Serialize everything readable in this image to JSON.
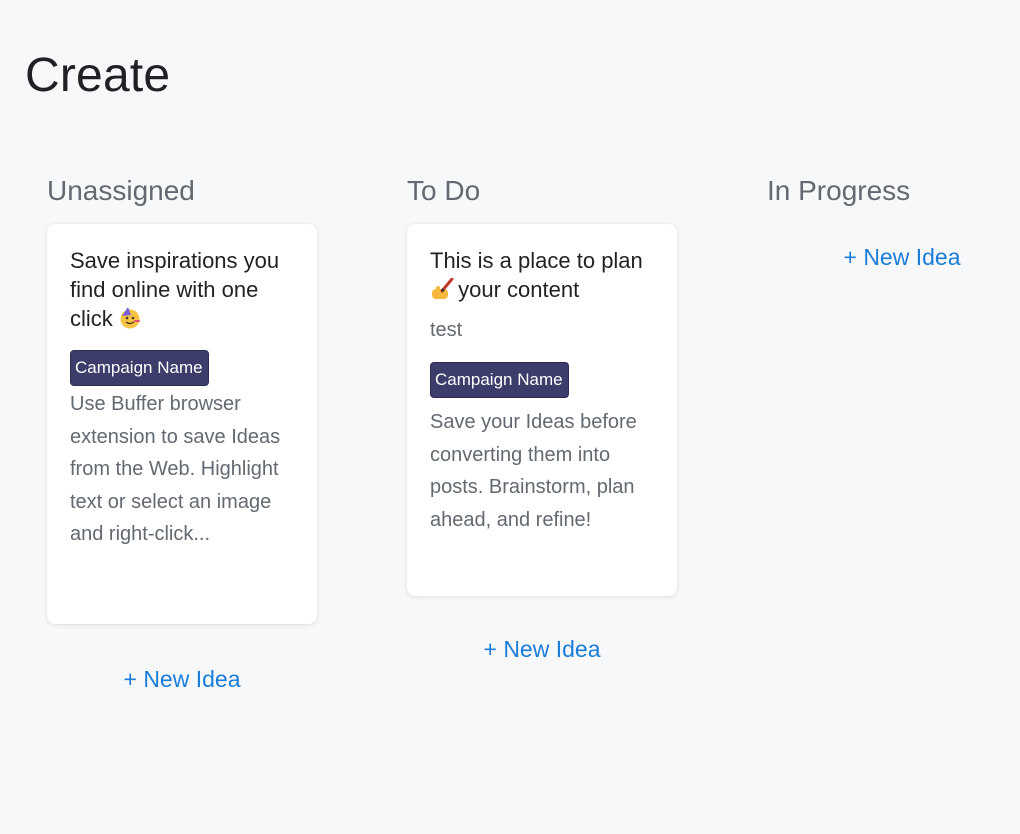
{
  "page": {
    "title": "Create"
  },
  "columns": [
    {
      "title": "Unassigned",
      "cards": [
        {
          "title": "Save inspirations you find online with one click",
          "emoji_icon": "party-face",
          "tag": "Campaign Name",
          "description": "Use Buffer browser extension to save Ideas from the Web. Highlight text or select an image and right-click..."
        }
      ],
      "new_idea_label": "+ New Idea"
    },
    {
      "title": "To Do",
      "cards": [
        {
          "title_before": "This is a place to plan",
          "emoji_icon": "writing-hand",
          "title_after": "your content",
          "subtext": "test",
          "tag": "Campaign Name",
          "description": "Save your Ideas before converting them into posts. Brainstorm, plan ahead, and refine!"
        }
      ],
      "new_idea_label": "+ New Idea"
    },
    {
      "title": "In Progress",
      "cards": [],
      "new_idea_label": "+ New Idea"
    }
  ],
  "colors": {
    "background": "#f7f8fa",
    "accent_link": "#1a7dd9",
    "tag_background": "#3d3d6b",
    "heading_text": "#1f2124",
    "muted_text": "#636970"
  }
}
